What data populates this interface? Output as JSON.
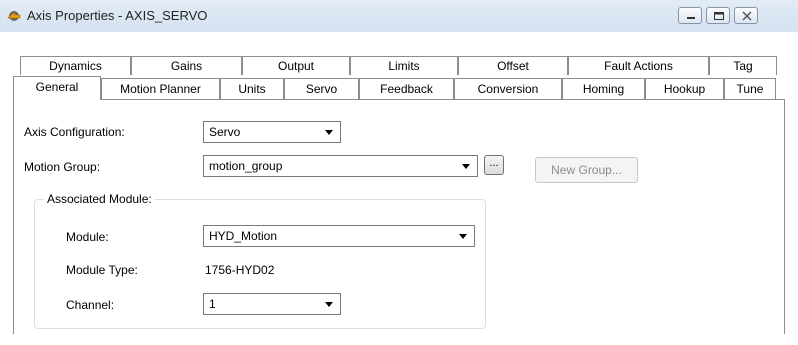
{
  "window": {
    "title": "Axis Properties - AXIS_SERVO",
    "icon": "gear-axis-icon",
    "buttons": [
      "minimize",
      "maximize",
      "close"
    ]
  },
  "tabs": {
    "row1": [
      "Dynamics",
      "Gains",
      "Output",
      "Limits",
      "Offset",
      "Fault Actions",
      "Tag"
    ],
    "row2": [
      "General",
      "Motion Planner",
      "Units",
      "Servo",
      "Feedback",
      "Conversion",
      "Homing",
      "Hookup",
      "Tune"
    ],
    "active": "General"
  },
  "form": {
    "axis_configuration": {
      "label": "Axis Configuration:",
      "value": "Servo"
    },
    "motion_group": {
      "label": "Motion Group:",
      "value": "motion_group",
      "ellipsis": "...",
      "new_group": "New Group..."
    },
    "associated_module": {
      "label": "Associated Module:",
      "module": {
        "label": "Module:",
        "value": "HYD_Motion"
      },
      "module_type": {
        "label": "Module Type:",
        "value": "1756-HYD02"
      },
      "channel": {
        "label": "Channel:",
        "value": "1"
      }
    }
  },
  "colors": {
    "titlebar": "#dae5f2",
    "tab_border": "#8d8d8d",
    "groupbox_border": "#d5dfe5",
    "disabled_text": "#8a8a8a"
  }
}
